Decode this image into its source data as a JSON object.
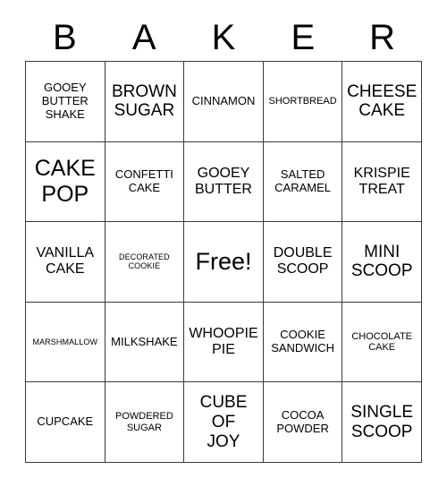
{
  "card": {
    "header_letters": [
      "B",
      "A",
      "K",
      "E",
      "R"
    ],
    "columns": 5,
    "rows": 5,
    "free_space_index": 12,
    "colors": {
      "background": "#ffffff",
      "cell_background": "#ffffff",
      "border": "#3a3a3a",
      "text": "#000000"
    },
    "cells": [
      {
        "text": "GOOEY\nBUTTER\nSHAKE",
        "size": "md"
      },
      {
        "text": "BROWN\nSUGAR",
        "size": "xl"
      },
      {
        "text": "CINNAMON",
        "size": "md"
      },
      {
        "text": "SHORTBREAD",
        "size": "sm"
      },
      {
        "text": "CHEESE\nCAKE",
        "size": "xl"
      },
      {
        "text": "CAKE\nPOP",
        "size": "xxl"
      },
      {
        "text": "CONFETTI\nCAKE",
        "size": "md"
      },
      {
        "text": "GOOEY\nBUTTER",
        "size": "lg"
      },
      {
        "text": "SALTED\nCARAMEL",
        "size": "md"
      },
      {
        "text": "KRISPIE\nTREAT",
        "size": "lg"
      },
      {
        "text": "VANILLA\nCAKE",
        "size": "lg"
      },
      {
        "text": "DECORATED\nCOOKIE",
        "size": "xs"
      },
      {
        "text": "Free!",
        "size": "free"
      },
      {
        "text": "DOUBLE\nSCOOP",
        "size": "lg"
      },
      {
        "text": "MINI\nSCOOP",
        "size": "xl"
      },
      {
        "text": "MARSHMALLOW",
        "size": "xs"
      },
      {
        "text": "MILKSHAKE",
        "size": "md"
      },
      {
        "text": "WHOOPIE\nPIE",
        "size": "lg"
      },
      {
        "text": "COOKIE\nSANDWICH",
        "size": "md"
      },
      {
        "text": "CHOCOLATE\nCAKE",
        "size": "sm"
      },
      {
        "text": "CUPCAKE",
        "size": "md"
      },
      {
        "text": "POWDERED\nSUGAR",
        "size": "sm"
      },
      {
        "text": "CUBE\nOF\nJOY",
        "size": "xl"
      },
      {
        "text": "COCOA\nPOWDER",
        "size": "md"
      },
      {
        "text": "SINGLE\nSCOOP",
        "size": "xl"
      }
    ]
  }
}
